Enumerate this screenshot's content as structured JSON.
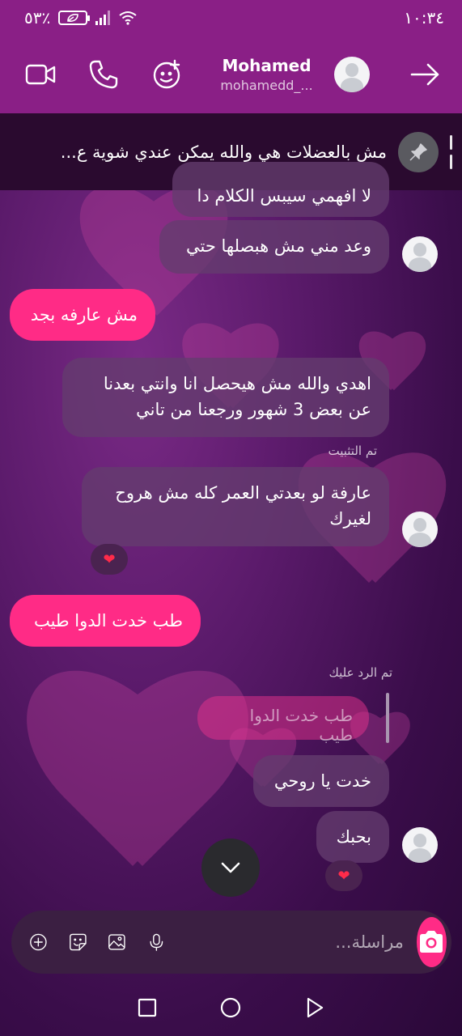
{
  "status_bar": {
    "time": "١٠:٣٤",
    "battery": "٥٣٪"
  },
  "header": {
    "name": "Mohamed",
    "handle": "mohamedd_..."
  },
  "pinned": {
    "text": "مش بالعضلات هي والله يمكن عندي شوية ع..."
  },
  "messages": [
    {
      "direction": "in",
      "text": "لا افهمي سيبس الكلام دا"
    },
    {
      "direction": "in",
      "text": "وعد مني مش هبصلها حتي"
    },
    {
      "direction": "out",
      "text": "مش عارفه بجد"
    },
    {
      "direction": "in",
      "text": "اهدي والله مش هيحصل انا وانتي بعدنا عن بعض 3 شهور ورجعنا من تاني"
    },
    {
      "direction": "in",
      "meta": "تم التثبيت",
      "text": "عارفة لو بعدتي العمر كله مش هروح لغيرك",
      "reaction": "❤"
    },
    {
      "direction": "out",
      "text": "طب خدت الدوا طيب"
    },
    {
      "direction": "in",
      "meta": "تم الرد عليك",
      "reply_to": "طب خدت الدوا طيب",
      "text": "خدت يا روحي"
    },
    {
      "direction": "in",
      "text": "بحبك",
      "reaction": "❤"
    }
  ],
  "composer": {
    "placeholder": "مراسلة..."
  },
  "colors": {
    "accent": "#ff2b86",
    "header": "#8a1f86"
  }
}
